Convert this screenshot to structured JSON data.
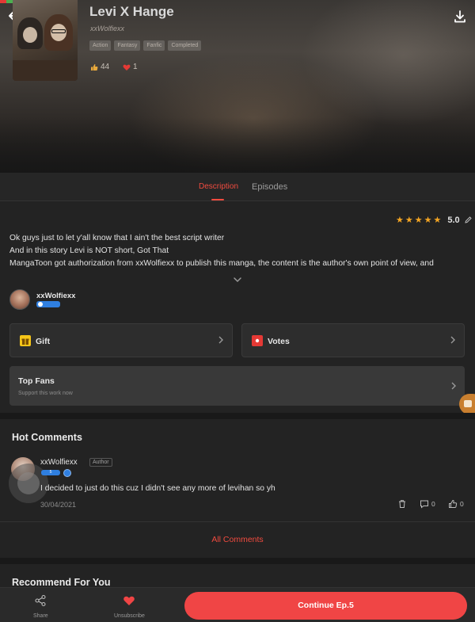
{
  "header": {
    "title": "Levi X Hange",
    "author": "xxWolfiexx",
    "tags": [
      "Action",
      "Fantasy",
      "Fanfic",
      "Completed"
    ],
    "likes": "44",
    "hearts": "1"
  },
  "tabs": [
    {
      "label": "Description",
      "active": true
    },
    {
      "label": "Episodes",
      "active": false
    }
  ],
  "description": {
    "rating": "5.0",
    "stars": 5,
    "lines": [
      "Ok guys just to let y'all know that I ain't the best script writer",
      "And in this story Levi is NOT short, Got That",
      "MangaToon got authorization from xxWolfiexx to publish this manga, the content is the author's own point of view, and"
    ]
  },
  "author_row": {
    "name": "xxWolfiexx"
  },
  "cards": {
    "gift": "Gift",
    "votes": "Votes",
    "top_fans_title": "Top Fans",
    "top_fans_sub": "Support this work now"
  },
  "comments": {
    "section_title": "Hot Comments",
    "items": [
      {
        "name": "xxWolfiexx",
        "role": "Author",
        "level": "5",
        "text": "I decided to just do this cuz I didn't see any more of levihan so yh",
        "date": "30/04/2021",
        "replies": "0",
        "likes": "0"
      }
    ],
    "all_label": "All Comments"
  },
  "recommend_title": "Recommend For You",
  "bottom_bar": {
    "share": "Share",
    "unsubscribe": "Unsubscribe",
    "continue": "Continue Ep.5"
  },
  "colors": {
    "accent": "#f04b3f",
    "background": "#232323",
    "star": "#f5a623",
    "gift_icon": "#f5c518",
    "votes_icon": "#e53935"
  }
}
